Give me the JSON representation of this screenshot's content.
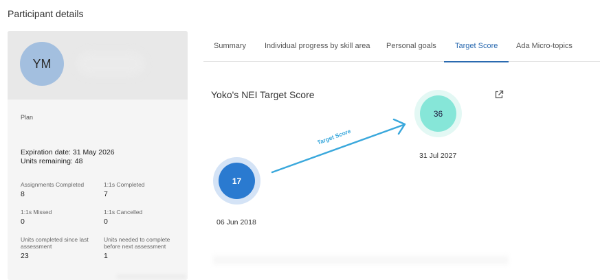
{
  "page": {
    "title": "Participant details"
  },
  "participant": {
    "initials": "YM",
    "plan_label": "Plan",
    "expiration": "Expiration date: 31 May 2026",
    "units_remaining": "Units remaining: 48",
    "stats": [
      {
        "label": "Assignments Completed",
        "value": "8"
      },
      {
        "label": "1:1s Completed",
        "value": "7"
      },
      {
        "label": "1:1s Missed",
        "value": "0"
      },
      {
        "label": "1:1s Cancelled",
        "value": "0"
      },
      {
        "label": "Units completed since last assessment",
        "value": "23"
      },
      {
        "label": "Units needed to complete before next assessment",
        "value": "1"
      }
    ]
  },
  "tabs": [
    {
      "label": "Summary",
      "active": false
    },
    {
      "label": "Individual progress by skill area",
      "active": false
    },
    {
      "label": "Personal goals",
      "active": false
    },
    {
      "label": "Target Score",
      "active": true
    },
    {
      "label": "Ada Micro-topics",
      "active": false
    }
  ],
  "target_score": {
    "title": "Yoko's NEI Target Score",
    "start": {
      "score": "17",
      "date": "06 Jun 2018"
    },
    "target": {
      "score": "36",
      "date": "31 Jul 2027"
    },
    "arrow_label": "Target Score",
    "icons": {
      "export": "external-link-icon"
    },
    "colors": {
      "start": "#2a7ad0",
      "target": "#86e6d8",
      "arrow": "#3aa8dc",
      "active_tab": "#2a6ab0"
    }
  }
}
